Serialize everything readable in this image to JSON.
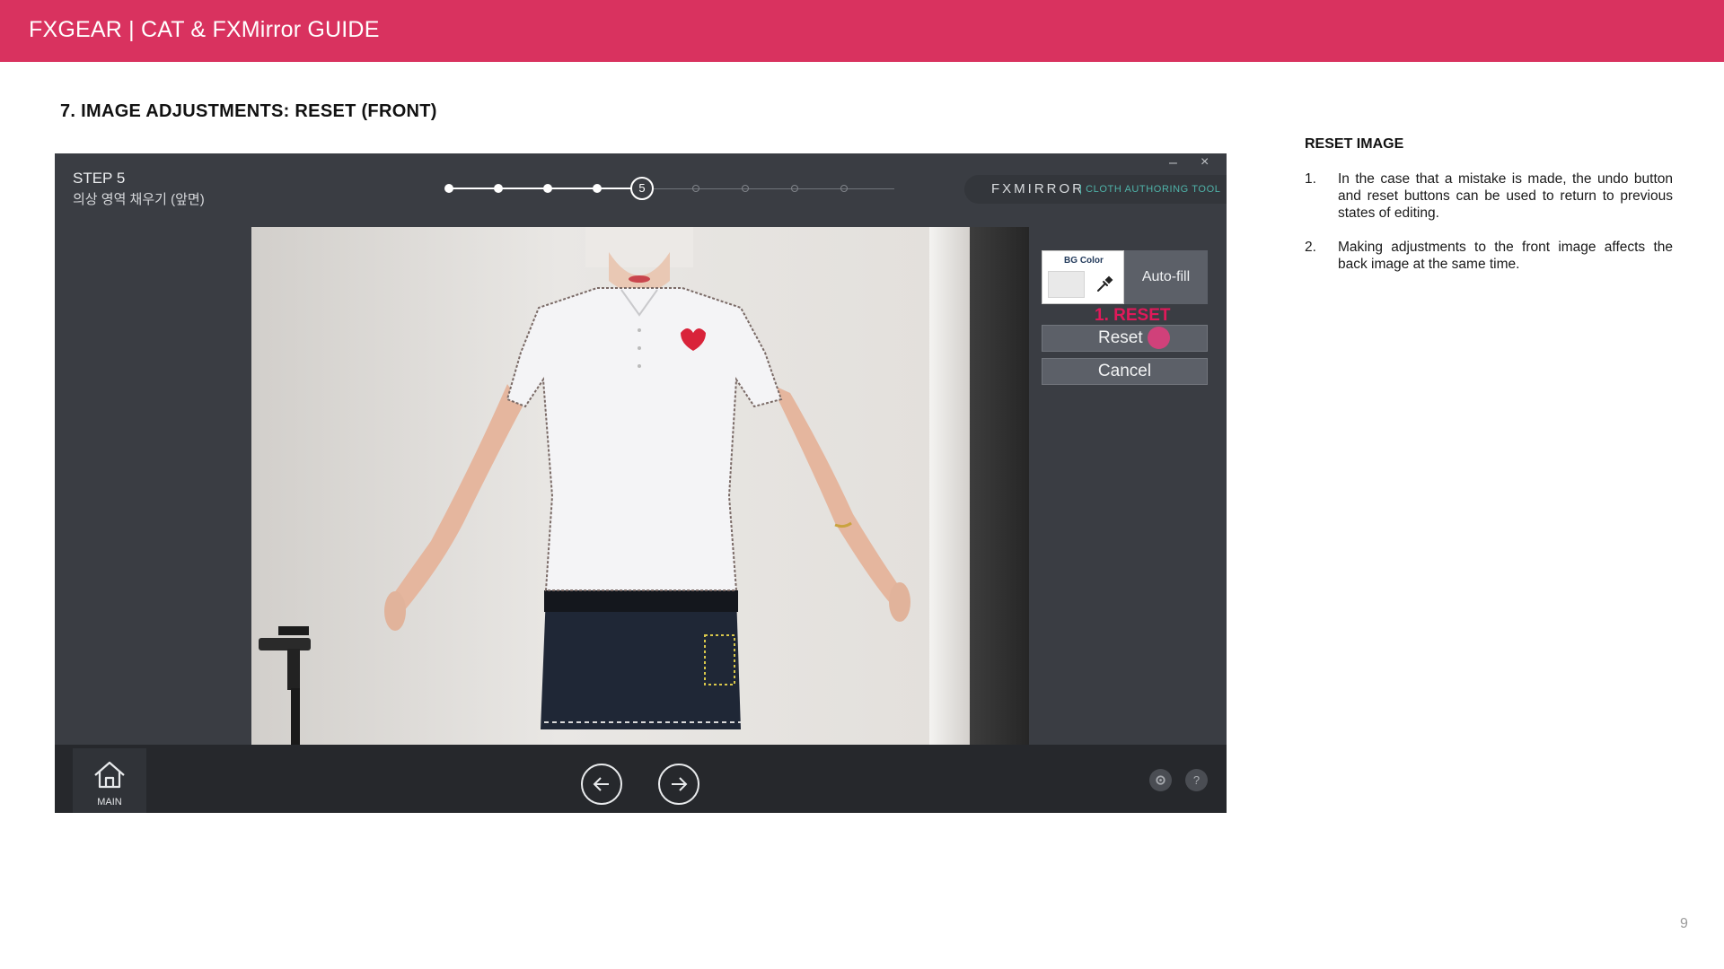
{
  "banner": {
    "title": "FXGEAR | CAT & FXMirror GUIDE"
  },
  "section": {
    "title": "7. IMAGE ADJUSTMENTS: RESET (FRONT)"
  },
  "app": {
    "window_controls": {
      "minimize": "–",
      "close": "×"
    },
    "step": {
      "title": "STEP 5",
      "subtitle": "의상 영역 채우기 (앞면)"
    },
    "progress": {
      "current_step": 5,
      "total_steps": 9,
      "current_label": "5"
    },
    "brand": {
      "name": "FXMIRROR",
      "tool": "| CLOTH AUTHORING TOOL"
    },
    "tools": {
      "bg_color_label": "BG Color",
      "bg_color_value": "#e9e9e9",
      "autofill_label": "Auto-fill",
      "reset_annotation": "1. RESET",
      "reset_label": "Reset",
      "cancel_label": "Cancel"
    },
    "bottom": {
      "main_label": "MAIN",
      "settings_icon": "gear-icon",
      "help_label": "?"
    }
  },
  "sidebar": {
    "heading": "RESET IMAGE",
    "items": [
      {
        "num": "1.",
        "text": "In the case that a mistake is made, the undo button and reset buttons can be used to return to previous states of editing."
      },
      {
        "num": "2.",
        "text": "Making adjustments to the front image affects the back image at the same time."
      }
    ]
  },
  "page": {
    "number": "9"
  },
  "colors": {
    "banner": "#d9325f",
    "annotation": "#e0195a",
    "marker": "#d0417a",
    "brand_accent": "#4fb3a9"
  }
}
